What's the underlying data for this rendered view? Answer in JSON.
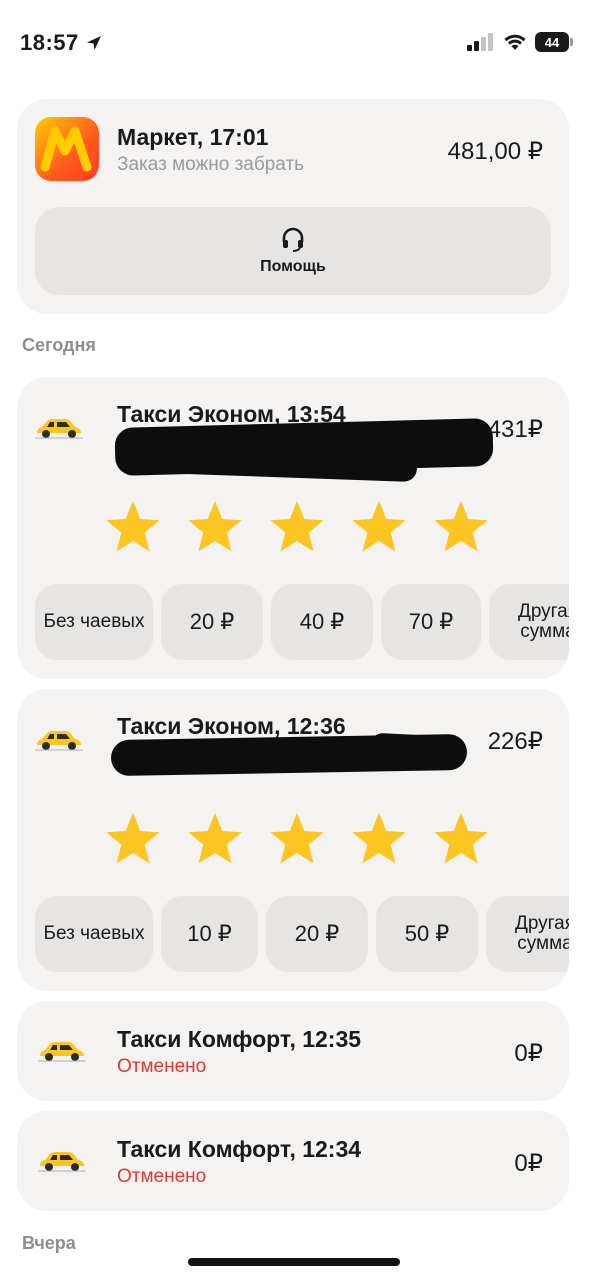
{
  "status_bar": {
    "time": "18:57",
    "battery": "44"
  },
  "market_order": {
    "title": "Маркет, 17:01",
    "subtitle": "Заказ можно забрать",
    "price": "481,00 ₽",
    "help_label": "Помощь"
  },
  "sections": {
    "today": "Сегодня",
    "yesterday": "Вчера"
  },
  "rides": [
    {
      "title": "Такси Эконом, 13:54",
      "price": "431₽",
      "rating_stars": 5,
      "tips": [
        "Без чаевых",
        "20 ₽",
        "40 ₽",
        "70 ₽",
        "Другая сумма"
      ]
    },
    {
      "title": "Такси Эконом, 12:36",
      "price": "226₽",
      "rating_stars": 5,
      "tips": [
        "Без чаевых",
        "10 ₽",
        "20 ₽",
        "50 ₽",
        "Другая сумма"
      ]
    },
    {
      "title": "Такси Комфорт, 12:35",
      "status": "Отменено",
      "price": "0₽"
    },
    {
      "title": "Такси Комфорт, 12:34",
      "status": "Отменено",
      "price": "0₽"
    }
  ],
  "colors": {
    "star": "#fcc521",
    "cancelled": "#e0382e",
    "card_bg": "#f4f3f1",
    "chip_bg": "#e6e5e3",
    "taxi": "#fcc521"
  }
}
